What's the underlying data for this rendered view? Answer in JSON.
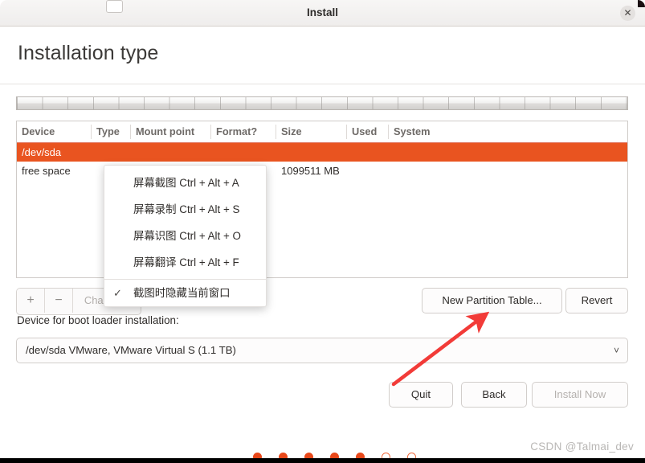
{
  "window": {
    "title": "Install",
    "close_icon": "close-icon"
  },
  "page": {
    "heading": "Installation type"
  },
  "partition_table": {
    "columns": [
      "Device",
      "Type",
      "Mount point",
      "Format?",
      "Size",
      "Used",
      "System"
    ],
    "rows": [
      {
        "device": "/dev/sda",
        "type": "",
        "mount": "",
        "format": "",
        "size": "",
        "used": "",
        "system": "",
        "selected": true
      },
      {
        "device": "free space",
        "type": "",
        "mount": "",
        "format": "",
        "size": "1099511 MB",
        "used": "",
        "system": "",
        "selected": false
      }
    ],
    "selection_color": "#e95420"
  },
  "toolbar": {
    "add_label": "+",
    "remove_label": "−",
    "change_label": "Change...",
    "new_partition_table_label": "New Partition Table...",
    "revert_label": "Revert"
  },
  "bootloader": {
    "label": "Device for boot loader installation:",
    "selected": "/dev/sda VMware, VMware Virtual S (1.1 TB)",
    "chevron_icon": "chevron-down-icon"
  },
  "footer": {
    "quit_label": "Quit",
    "back_label": "Back",
    "install_now_label": "Install Now"
  },
  "context_menu": {
    "items": [
      {
        "label": "屏幕截图 Ctrl + Alt + A",
        "checked": false
      },
      {
        "label": "屏幕录制 Ctrl + Alt + S",
        "checked": false
      },
      {
        "label": "屏幕识图 Ctrl + Alt + O",
        "checked": false
      },
      {
        "label": "屏幕翻译 Ctrl + Alt + F",
        "checked": false
      },
      {
        "label": "截图时隐藏当前窗口",
        "checked": true
      }
    ],
    "check_glyph": "✓"
  },
  "progress_dots": {
    "total": 7,
    "filled": 5,
    "filled_color": "#e8481a",
    "hollow_color": "#ef6a3d"
  },
  "watermark": {
    "text": "CSDN @Talmai_dev"
  },
  "annotation": {
    "arrow_color": "#f23b38"
  }
}
